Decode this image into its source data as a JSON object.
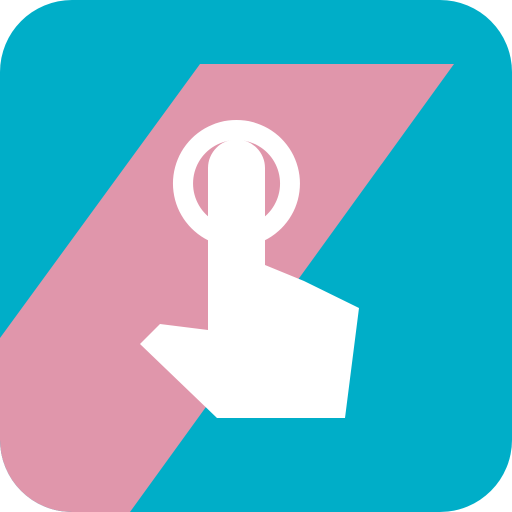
{
  "icon": {
    "name": "tap-gesture-app-icon",
    "glyph": "pointing-hand-tap-icon",
    "colors": {
      "background": "#00aec8",
      "stripe": "#e096ab",
      "glyph": "#ffffff"
    }
  }
}
